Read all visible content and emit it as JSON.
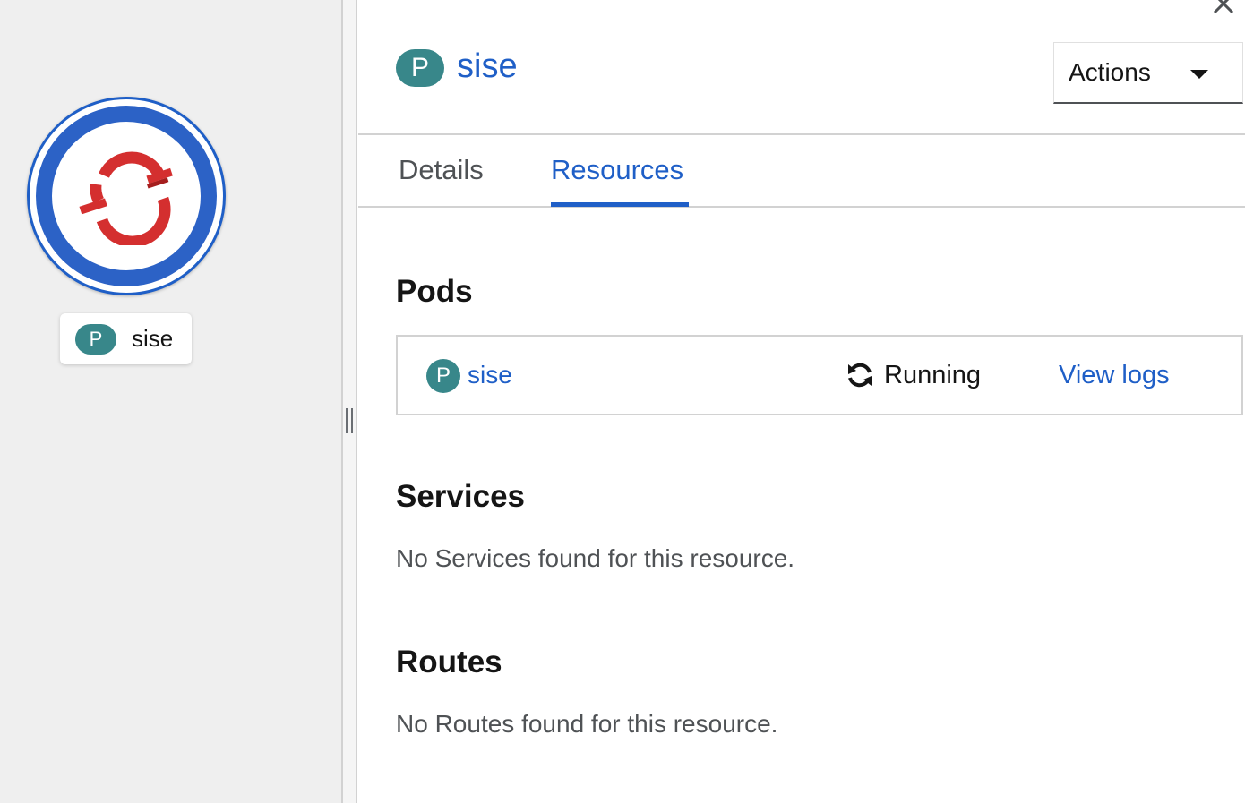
{
  "topology": {
    "node": {
      "badge": "P",
      "name": "sise",
      "icon": "openshift-logo-icon"
    }
  },
  "side_panel": {
    "header": {
      "badge": "P",
      "title": "sise",
      "actions_label": "Actions"
    },
    "tabs": [
      {
        "label": "Details",
        "active": false
      },
      {
        "label": "Resources",
        "active": true
      }
    ],
    "pods": {
      "title": "Pods",
      "items": [
        {
          "badge": "P",
          "name": "sise",
          "status": "Running",
          "status_icon": "sync-icon",
          "logs_link": "View logs"
        }
      ]
    },
    "services": {
      "title": "Services",
      "empty_text": "No Services found for this resource."
    },
    "routes": {
      "title": "Routes",
      "empty_text": "No Routes found for this resource."
    }
  },
  "colors": {
    "accent": "#1f5fc7",
    "badge": "#38878a",
    "canvas_bg": "#efefef",
    "logo_red": "#d42f2f"
  }
}
